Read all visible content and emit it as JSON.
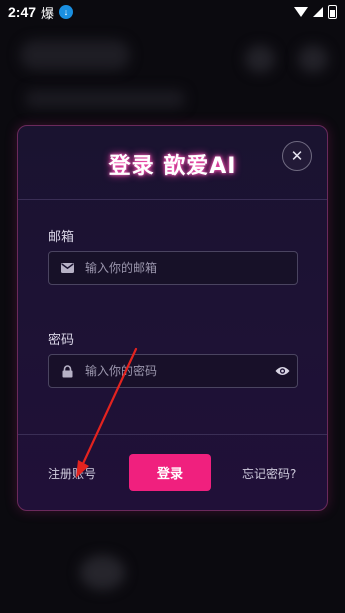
{
  "status_bar": {
    "time": "2:47",
    "extra_glyph": "爆"
  },
  "dialog": {
    "title": "登录 歆爱AI",
    "close_symbol": "✕",
    "email": {
      "label": "邮箱",
      "placeholder": "输入你的邮箱",
      "value": ""
    },
    "password": {
      "label": "密码",
      "placeholder": "输入你的密码",
      "value": ""
    },
    "register_link": "注册账号",
    "login_button": "登录",
    "forgot_link": "忘记密码?"
  },
  "icons": {
    "status": [
      "download-icon",
      "wifi-icon",
      "signal-icon",
      "battery-icon"
    ],
    "fields": [
      "mail-icon",
      "lock-icon",
      "eye-icon"
    ],
    "annotation": "red-arrow"
  },
  "colors": {
    "accent": "#f0207e",
    "annotation_arrow": "#e3231f"
  }
}
